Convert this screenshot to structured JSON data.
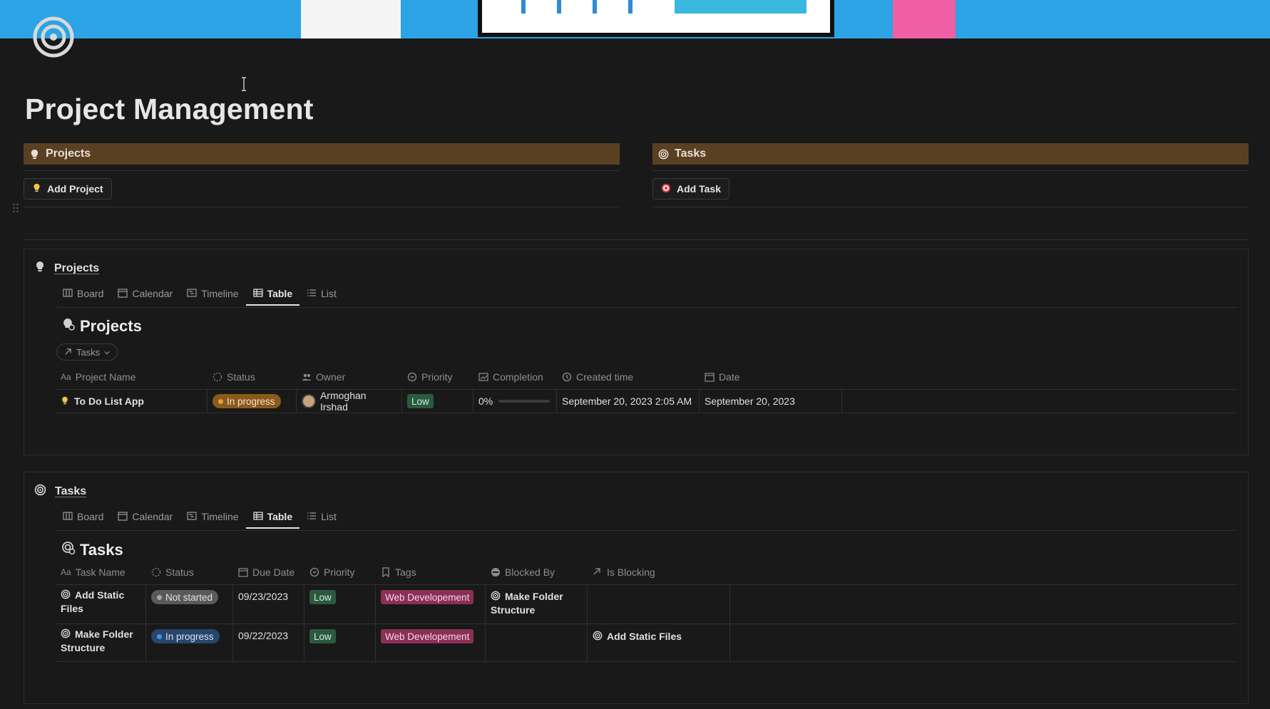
{
  "page": {
    "title": "Project Management"
  },
  "callouts": {
    "projects": {
      "title": "Projects",
      "button": "Add Project"
    },
    "tasks": {
      "title": "Tasks",
      "button": "Add Task"
    }
  },
  "projects_db": {
    "link_title": "Projects",
    "views": [
      "Board",
      "Calendar",
      "Timeline",
      "Table",
      "List"
    ],
    "active_view": "Table",
    "table_title": "Projects",
    "filter_chip": "Tasks",
    "columns": [
      "Project Name",
      "Status",
      "Owner",
      "Priority",
      "Completion",
      "Created time",
      "Date"
    ],
    "rows": [
      {
        "name": "To Do List App",
        "status": "In progress",
        "owner": "Armoghan Irshad",
        "priority": "Low",
        "completion_label": "0%",
        "completion_value": 0,
        "created": "September 20, 2023 2:05 AM",
        "date": "September 20, 2023"
      }
    ]
  },
  "tasks_db": {
    "link_title": "Tasks",
    "views": [
      "Board",
      "Calendar",
      "Timeline",
      "Table",
      "List"
    ],
    "active_view": "Table",
    "table_title": "Tasks",
    "columns": [
      "Task Name",
      "Status",
      "Due Date",
      "Priority",
      "Tags",
      "Blocked By",
      "Is Blocking"
    ],
    "rows": [
      {
        "name_line1": "Add Static",
        "name_line2": "Files",
        "status": "Not started",
        "due": "09/23/2023",
        "priority": "Low",
        "tag": "Web Developement",
        "blocked_by_line1": "Make Folder",
        "blocked_by_line2": "Structure",
        "is_blocking": ""
      },
      {
        "name_line1": "Make Folder",
        "name_line2": "Structure",
        "status": "In progress",
        "due": "09/22/2023",
        "priority": "Low",
        "tag": "Web Developement",
        "blocked_by_line1": "",
        "blocked_by_line2": "",
        "is_blocking": "Add Static Files"
      }
    ]
  },
  "colors": {
    "background": "#191919",
    "callout": "#5a4023",
    "status_in_progress_projects": "#8a5a1c",
    "status_in_progress_tasks": "#28456c",
    "status_not_started": "#5a5a5a",
    "priority_low": "#2b593f",
    "tag_web": "#8a2f55"
  },
  "icons": {
    "page": "target-icon",
    "projects": "lightbulb-icon",
    "tasks": "target-icon",
    "add_task": "dart-icon"
  }
}
